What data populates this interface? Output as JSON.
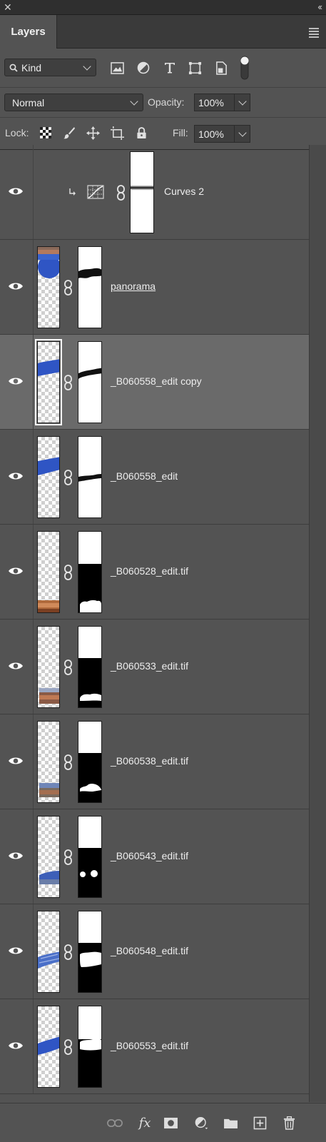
{
  "panel": {
    "tab_label": "Layers"
  },
  "filter": {
    "kind_label": "Kind",
    "icons": [
      "pixel-filter-icon",
      "adjustment-filter-icon",
      "type-filter-icon",
      "shape-filter-icon",
      "smart-object-filter-icon",
      "filter-toggle"
    ]
  },
  "blend": {
    "mode": "Normal",
    "opacity_label": "Opacity:",
    "opacity_value": "100%"
  },
  "lock": {
    "label": "Lock:",
    "fill_label": "Fill:",
    "fill_value": "100%"
  },
  "layers": [
    {
      "name": "Curves 2",
      "type": "adjustment",
      "selected": false
    },
    {
      "name": "panorama",
      "type": "pixel",
      "selected": false,
      "underline": true
    },
    {
      "name": "_B060558_edit copy",
      "type": "pixel",
      "selected": true
    },
    {
      "name": "_B060558_edit",
      "type": "pixel",
      "selected": false
    },
    {
      "name": "_B060528_edit.tif",
      "type": "pixel",
      "selected": false
    },
    {
      "name": "_B060533_edit.tif",
      "type": "pixel",
      "selected": false
    },
    {
      "name": "_B060538_edit.tif",
      "type": "pixel",
      "selected": false
    },
    {
      "name": "_B060543_edit.tif",
      "type": "pixel",
      "selected": false
    },
    {
      "name": "_B060548_edit.tif",
      "type": "pixel",
      "selected": false
    },
    {
      "name": "_B060553_edit.tif",
      "type": "pixel",
      "selected": false
    }
  ],
  "bottom_toolbar": {
    "fx_label": "fx",
    "icons": [
      "link-layers-icon",
      "fx-icon",
      "add-mask-icon",
      "new-adjustment-icon",
      "new-group-icon",
      "new-layer-icon",
      "delete-layer-icon"
    ]
  },
  "colors": {
    "panel_bg": "#535353",
    "selected_row": "#6a6a6a",
    "brush_blue": "#2f55c4"
  }
}
